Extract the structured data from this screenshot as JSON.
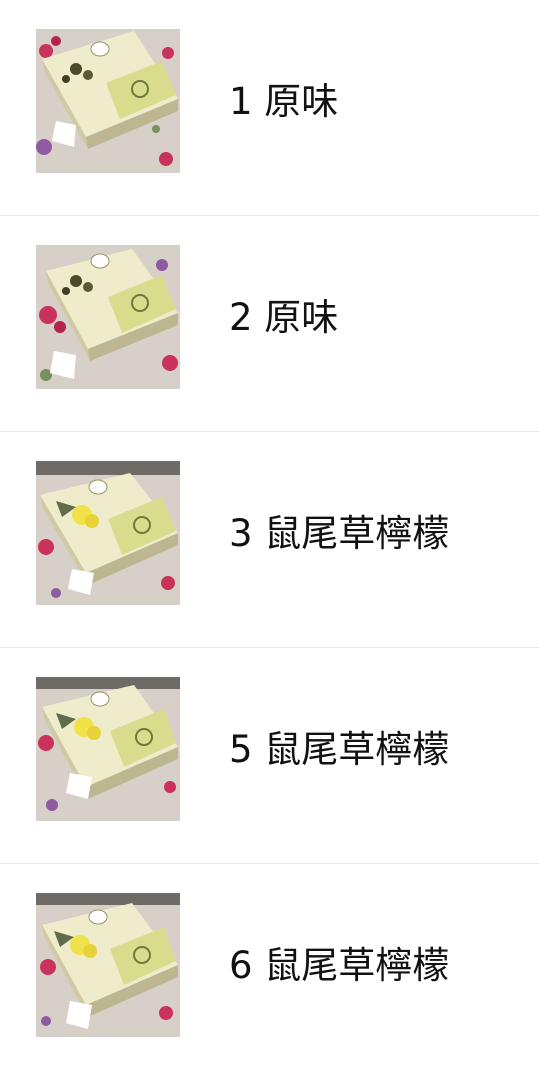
{
  "items": [
    {
      "label": "1 原味",
      "variant": "original",
      "image_icon": "olive-soap-box-image"
    },
    {
      "label": "2 原味",
      "variant": "original",
      "image_icon": "olive-soap-box-image"
    },
    {
      "label": "3 鼠尾草檸檬",
      "variant": "lemon",
      "image_icon": "olive-soap-box-image"
    },
    {
      "label": "5 鼠尾草檸檬",
      "variant": "lemon",
      "image_icon": "olive-soap-box-image"
    },
    {
      "label": "6 鼠尾草檸檬",
      "variant": "lemon",
      "image_icon": "olive-soap-box-image"
    }
  ],
  "colors": {
    "background": "#ffffff",
    "divider": "#e6e6e6",
    "text": "#111111",
    "box_cream": "#efeccc",
    "box_green": "#d8dd8e",
    "olive_dark": "#4a4a2a",
    "lemon": "#f2e24a",
    "flower_pink": "#c9325a"
  }
}
